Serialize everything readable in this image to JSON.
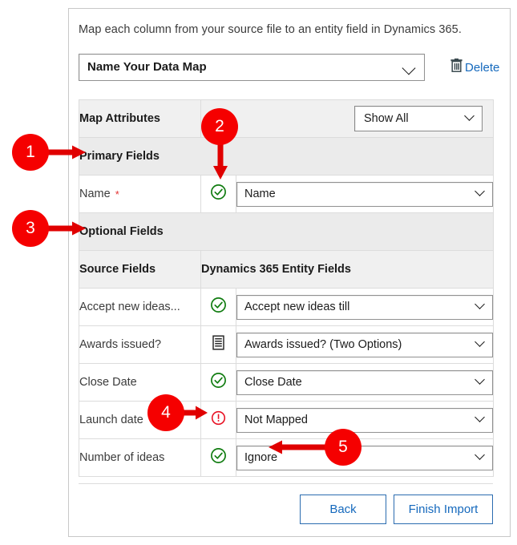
{
  "dialog": {
    "instruction": "Map each column from your source file to an entity field in Dynamics 365.",
    "map_name": {
      "value": "Name Your Data Map",
      "chevron_icon": "chevron-down-icon"
    },
    "delete": {
      "label": "Delete",
      "icon": "trash-icon",
      "color": "#1569bd"
    }
  },
  "table": {
    "attributes_header": {
      "label": "Map Attributes",
      "filter_value": "Show All"
    },
    "groups": [
      {
        "label": "Primary Fields"
      },
      {
        "label": "Optional Fields"
      }
    ],
    "column_headers": {
      "source": "Source Fields",
      "target": "Dynamics 365 Entity Fields"
    },
    "primary_rows": [
      {
        "source": "Name",
        "required": true,
        "required_mark": "*",
        "status_icon": "check-circle-icon",
        "status": "mapped",
        "target": "Name"
      }
    ],
    "optional_rows": [
      {
        "source": "Accept new ideas...",
        "status_icon": "check-circle-icon",
        "status": "mapped",
        "target": "Accept new ideas till"
      },
      {
        "source": "Awards issued?",
        "status_icon": "option-set-icon",
        "status": "option-set",
        "target": "Awards issued? (Two Options)"
      },
      {
        "source": "Close Date",
        "status_icon": "check-circle-icon",
        "status": "mapped",
        "target": "Close Date"
      },
      {
        "source": "Launch date",
        "status_icon": "error-circle-icon",
        "status": "not-mapped",
        "target": "Not Mapped"
      },
      {
        "source": "Number of ideas",
        "status_icon": "check-circle-icon",
        "status": "mapped",
        "target": "Ignore"
      }
    ]
  },
  "footer": {
    "back_label": "Back",
    "finish_label": "Finish Import"
  },
  "callouts": [
    {
      "number": "1"
    },
    {
      "number": "2"
    },
    {
      "number": "3"
    },
    {
      "number": "4"
    },
    {
      "number": "5"
    }
  ],
  "colors": {
    "callout_red": "#f50000",
    "link_blue": "#1569bd",
    "success_green": "#107c10",
    "error_red": "#e81123",
    "required_red": "#e33232"
  }
}
